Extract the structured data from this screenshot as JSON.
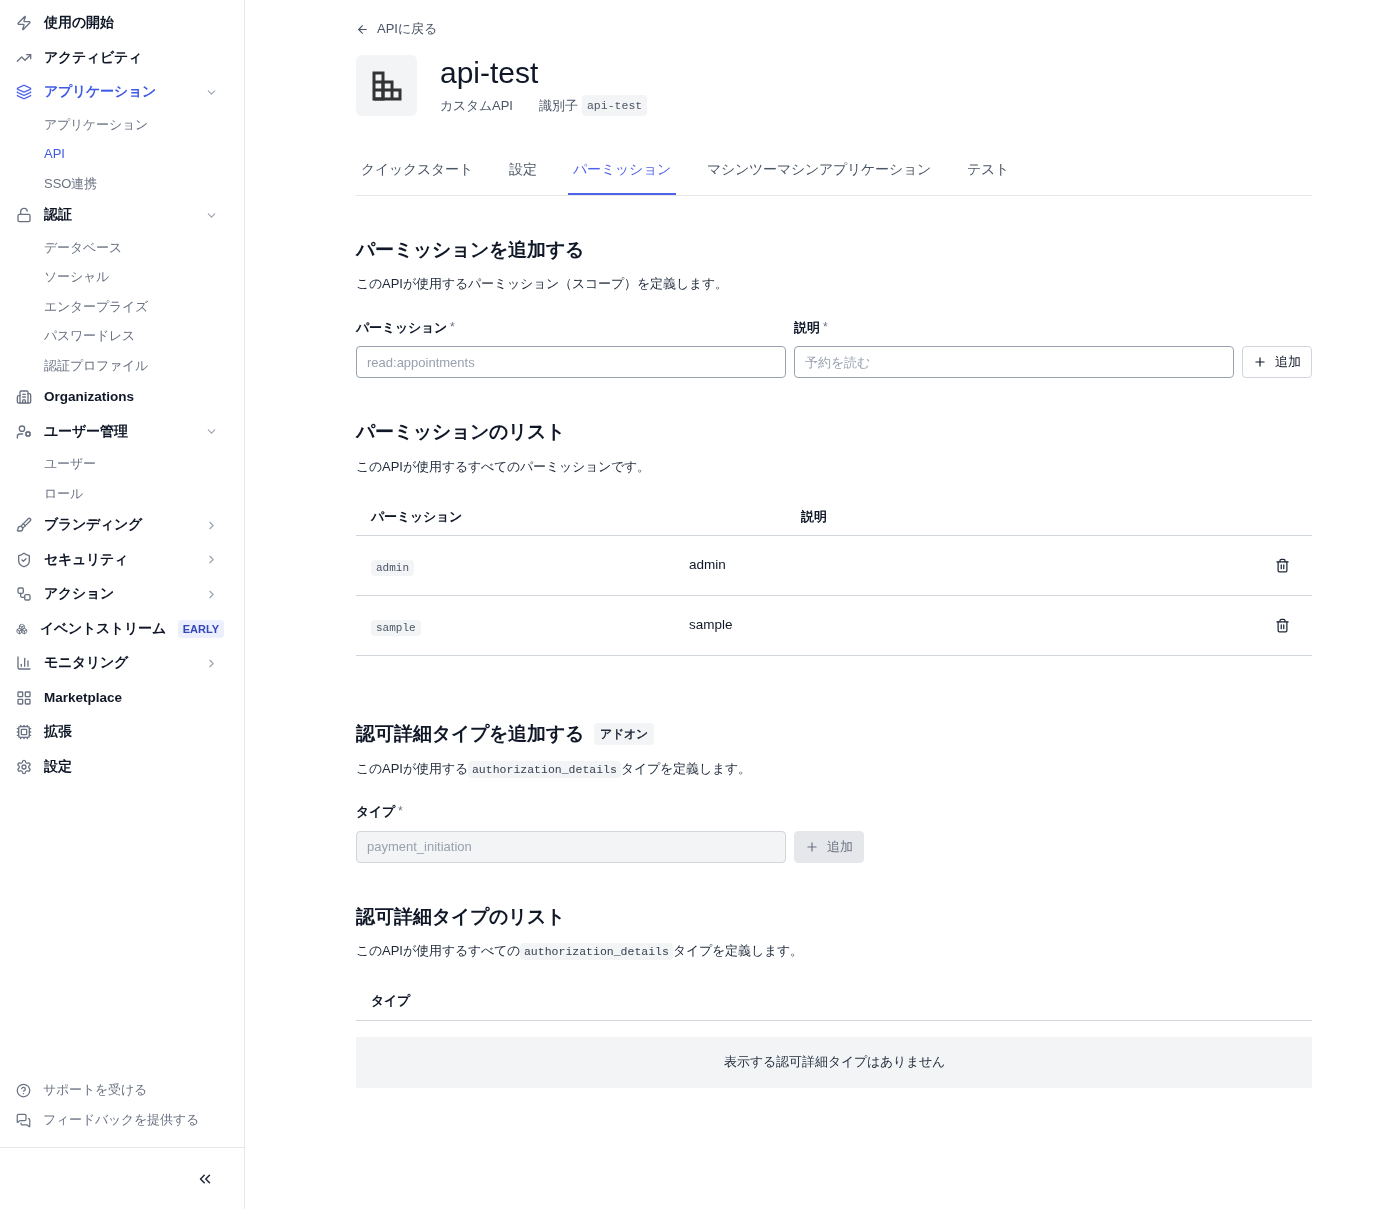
{
  "sidebar": {
    "items": [
      {
        "label": "使用の開始",
        "selected": false
      },
      {
        "label": "アクティビティ",
        "selected": false
      },
      {
        "label": "アプリケーション",
        "selected": true,
        "expanded": true,
        "children": [
          {
            "label": "アプリケーション",
            "selected": false
          },
          {
            "label": "API",
            "selected": true
          },
          {
            "label": "SSO連携",
            "selected": false
          }
        ]
      },
      {
        "label": "認証",
        "selected": false,
        "expanded": true,
        "children": [
          {
            "label": "データベース",
            "selected": false
          },
          {
            "label": "ソーシャル",
            "selected": false
          },
          {
            "label": "エンタープライズ",
            "selected": false
          },
          {
            "label": "パスワードレス",
            "selected": false
          },
          {
            "label": "認証プロファイル",
            "selected": false
          }
        ]
      },
      {
        "label": "Organizations",
        "selected": false
      },
      {
        "label": "ユーザー管理",
        "selected": false,
        "expanded": true,
        "children": [
          {
            "label": "ユーザー",
            "selected": false
          },
          {
            "label": "ロール",
            "selected": false
          }
        ]
      },
      {
        "label": "ブランディング",
        "selected": false,
        "expanded": false
      },
      {
        "label": "セキュリティ",
        "selected": false,
        "expanded": false
      },
      {
        "label": "アクション",
        "selected": false,
        "expanded": false
      },
      {
        "label": "イベントストリーム",
        "selected": false,
        "badge": "EARLY"
      },
      {
        "label": "モニタリング",
        "selected": false,
        "expanded": false
      },
      {
        "label": "Marketplace",
        "selected": false
      },
      {
        "label": "拡張",
        "selected": false
      },
      {
        "label": "設定",
        "selected": false
      }
    ],
    "footer_links": [
      "サポートを受ける",
      "フィードバックを提供する"
    ]
  },
  "back_link": "APIに戻る",
  "header": {
    "title": "api-test",
    "type": "カスタムAPI",
    "identifier_label": "識別子",
    "identifier": "api-test"
  },
  "tabs": [
    {
      "label": "クイックスタート",
      "selected": false
    },
    {
      "label": "設定",
      "selected": false
    },
    {
      "label": "パーミッション",
      "selected": true
    },
    {
      "label": "マシンツーマシンアプリケーション",
      "selected": false
    },
    {
      "label": "テスト",
      "selected": false
    }
  ],
  "add_permission": {
    "title": "パーミッションを追加する",
    "description": [
      {
        "kind": "text",
        "text": "このAPIが使用するパーミッション（スコープ）を定義します。"
      }
    ],
    "fields": [
      {
        "label": "パーミッション",
        "required_mark": "*",
        "placeholder": "read:appointments"
      },
      {
        "label": "説明",
        "required_mark": "*",
        "placeholder": "予約を読む"
      }
    ],
    "button": "追加",
    "disabled": false
  },
  "permission_list": {
    "title": "パーミッションのリスト",
    "description": [
      {
        "kind": "text",
        "text": "このAPIが使用するすべてのパーミッションです。"
      }
    ],
    "columns": [
      "パーミッション",
      "説明"
    ],
    "rows": [
      {
        "permission": "admin",
        "description": "admin"
      },
      {
        "permission": "sample",
        "description": "sample"
      }
    ]
  },
  "add_authorization_type": {
    "title": "認可詳細タイプを追加する",
    "badge": "アドオン",
    "description": [
      {
        "kind": "text",
        "text": "このAPIが使用する"
      },
      {
        "kind": "code",
        "text": "authorization_details"
      },
      {
        "kind": "text",
        "text": "タイプを定義します。"
      }
    ],
    "fields": [
      {
        "label": "タイプ",
        "required_mark": "*",
        "placeholder": "payment_initiation"
      }
    ],
    "button": "追加",
    "disabled": true
  },
  "authorization_type_list": {
    "title": "認可詳細タイプのリスト",
    "description": [
      {
        "kind": "text",
        "text": "このAPIが使用するすべての"
      },
      {
        "kind": "code",
        "text": "authorization_details"
      },
      {
        "kind": "text",
        "text": "タイプを定義します。"
      }
    ],
    "columns": [
      "タイプ"
    ],
    "empty_message": "表示する認可詳細タイプはありません"
  }
}
